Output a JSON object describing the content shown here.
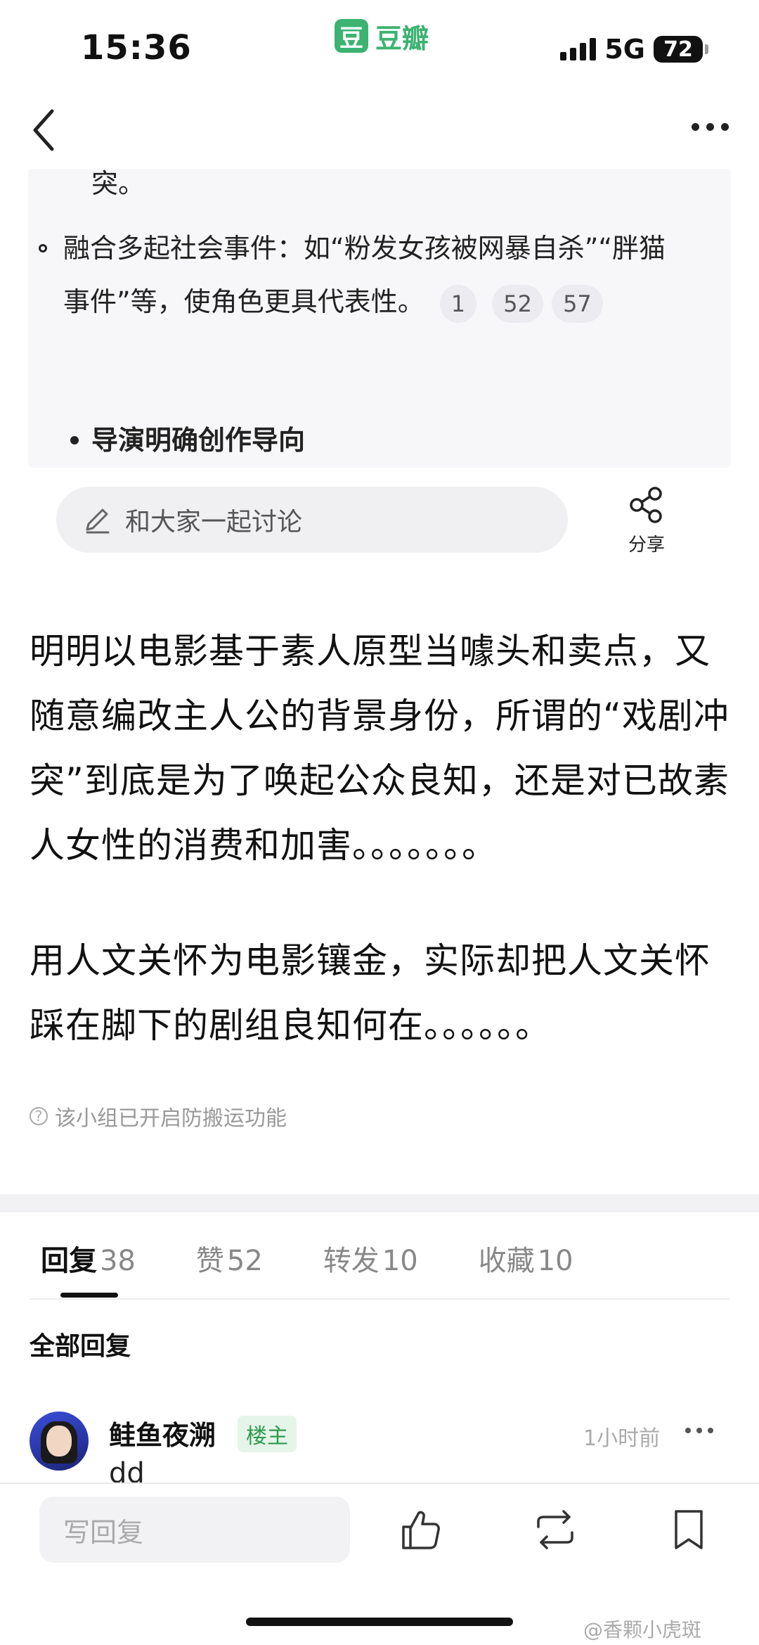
{
  "status_bar": {
    "time": "15:36",
    "app_name": "豆瓣",
    "app_logo_char": "豆",
    "network": "5G",
    "battery": "72"
  },
  "card": {
    "cut_text": "突。",
    "bullet1_text": "融合多起社会事件：如“粉发女孩被网暴自杀”“胖猫事件”等，使角色更具代表性。",
    "refs": [
      "1",
      "52",
      "57"
    ],
    "bullet2_text": "导演明确创作导向"
  },
  "discuss": {
    "placeholder": "和大家一起讨论",
    "share_label": "分享"
  },
  "post": {
    "para1": "明明以电影基于素人原型当噱头和卖点，又随意编改主人公的背景身份，所谓的“戏剧冲突”到底是为了唤起公众良知，还是对已故素人女性的消费和加害。。。。。。。",
    "para2": "用人文关怀为电影镶金，实际却把人文关怀踩在脚下的剧组良知何在。。。。。。",
    "notice": "该小组已开启防搬运功能"
  },
  "tabs": [
    {
      "label": "回复",
      "count": "38"
    },
    {
      "label": "赞",
      "count": "52"
    },
    {
      "label": "转发",
      "count": "10"
    },
    {
      "label": "收藏",
      "count": "10"
    }
  ],
  "replies_header": "全部回复",
  "comment": {
    "author": "鲑鱼夜溯",
    "badge": "楼主",
    "time": "1小时前",
    "text": "dd"
  },
  "bottom_bar": {
    "reply_placeholder": "写回复"
  },
  "watermark": "@香颗小虎斑",
  "colors": {
    "brand_green": "#3cb371",
    "badge_green": "#2f9b4e"
  }
}
